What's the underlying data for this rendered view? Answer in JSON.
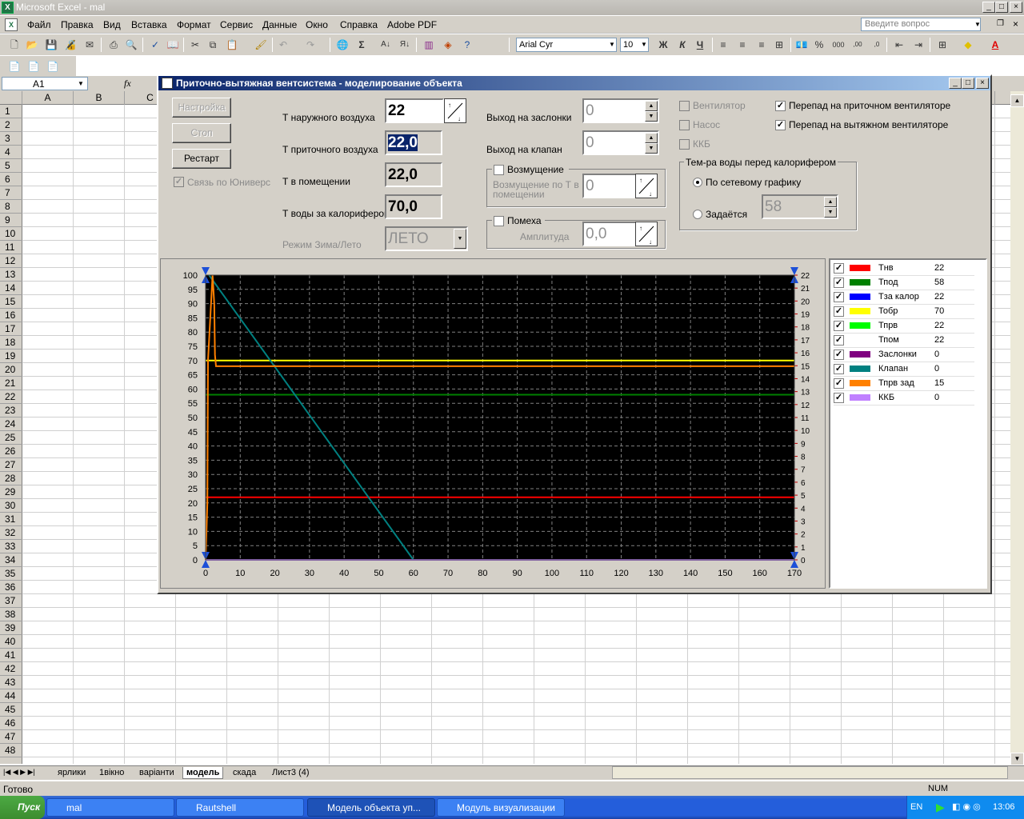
{
  "app": {
    "title": "Microsoft Excel - mal"
  },
  "menu": {
    "items": [
      "Файл",
      "Правка",
      "Вид",
      "Вставка",
      "Формат",
      "Сервис",
      "Данные",
      "Окно",
      "Справка",
      "Adobe PDF"
    ],
    "ask_placeholder": "Введите вопрос"
  },
  "toolbar": {
    "font": "Arial Cyr",
    "size": "10",
    "bold": "Ж",
    "italic": "К",
    "underline": "Ч",
    "percent": "%",
    "thousands": "000"
  },
  "formula": {
    "cell": "A1",
    "fx": "fx"
  },
  "grid": {
    "columns": [
      "A",
      "B",
      "C"
    ],
    "rows": [
      "1",
      "2",
      "3",
      "4",
      "5",
      "6",
      "7",
      "8",
      "9",
      "10",
      "11",
      "12",
      "13",
      "14",
      "15",
      "16",
      "17",
      "18",
      "19",
      "20",
      "21",
      "22",
      "23",
      "24",
      "25",
      "26",
      "27",
      "28",
      "29",
      "30",
      "31",
      "32",
      "33",
      "34",
      "35",
      "36",
      "37",
      "38",
      "39",
      "40",
      "41",
      "42",
      "43",
      "44",
      "45",
      "46",
      "47",
      "48"
    ]
  },
  "sheets": {
    "tabs": [
      "ярлики",
      "1вікно",
      "варіанти",
      "модель",
      "скада",
      "Лист3 (4)"
    ],
    "active": "модель"
  },
  "status": {
    "left": "Готово",
    "num": "NUM"
  },
  "taskbar": {
    "start": "Пуск",
    "tasks": [
      "mal",
      "Rautshell",
      "Модель объекта уп...",
      "Модуль визуализации"
    ],
    "lang": "EN",
    "clock": "13:06"
  },
  "dialog": {
    "title": "Приточно-вытяжная вентсистема - моделирование объекта",
    "buttons": {
      "setup": "Настройка",
      "stop": "Стоп",
      "restart": "Рестарт"
    },
    "link_label": "Связь по Юниверс",
    "fields": {
      "outdoor_label": "Т наружного воздуха",
      "outdoor_value": "22",
      "supply_label": "Т приточного воздуха",
      "supply_value": "22,0",
      "room_label": "Т в помещении",
      "room_value": "22,0",
      "water_label": "Т воды за калорифером",
      "water_value": "70,0",
      "mode_label": "Режим Зима/Лето",
      "mode_value": "ЛЕТО",
      "damper_label": "Выход на заслонки",
      "damper_value": "0",
      "valve_label": "Выход на клапан",
      "valve_value": "0",
      "disturb_label": "Возмущение",
      "disturb_sub_label": "Возмущение по Т в помещении",
      "disturb_value": "0",
      "noise_label": "Помеха",
      "amplitude_label": "Амплитуда",
      "amplitude_value": "0,0"
    },
    "checks": {
      "fan": "Вентилятор",
      "pump": "Насос",
      "kkb": "ККБ",
      "supply_dp": "Перепад на приточном вентиляторе",
      "exhaust_dp": "Перепад на вытяжном вентиляторе"
    },
    "water_group": {
      "title": "Тем-ра воды перед калорифером",
      "by_schedule": "По сетевому графику",
      "manual": "Задаётся",
      "manual_value": "58"
    }
  },
  "legend": [
    {
      "name": "Тнв",
      "value": "22",
      "color": "#ff0000",
      "checked": true
    },
    {
      "name": "Тпод",
      "value": "58",
      "color": "#008000",
      "checked": true
    },
    {
      "name": "Тза калор",
      "value": "22",
      "color": "#0000ff",
      "checked": true
    },
    {
      "name": "Тобр",
      "value": "70",
      "color": "#ffff00",
      "checked": true
    },
    {
      "name": "Тпрв",
      "value": "22",
      "color": "#00ff00",
      "checked": true
    },
    {
      "name": "Тпом",
      "value": "22",
      "color": "#ffffff",
      "checked": true
    },
    {
      "name": "Заслонки",
      "value": "0",
      "color": "#800080",
      "checked": true
    },
    {
      "name": "Клапан",
      "value": "0",
      "color": "#008080",
      "checked": true
    },
    {
      "name": "Тпрв зад",
      "value": "15",
      "color": "#ff8000",
      "checked": true
    },
    {
      "name": "ККБ",
      "value": "0",
      "color": "#c080ff",
      "checked": true
    }
  ],
  "chart_data": {
    "type": "line",
    "x_ticks": [
      0,
      10,
      20,
      30,
      40,
      50,
      60,
      70,
      80,
      90,
      100,
      110,
      120,
      130,
      140,
      150,
      160,
      170
    ],
    "y_left_ticks": [
      0,
      5,
      10,
      15,
      20,
      25,
      30,
      35,
      40,
      45,
      50,
      55,
      60,
      65,
      70,
      75,
      80,
      85,
      90,
      95,
      100
    ],
    "y_right_ticks": [
      0,
      1,
      2,
      3,
      4,
      5,
      6,
      7,
      8,
      9,
      10,
      11,
      12,
      13,
      14,
      15,
      16,
      17,
      18,
      19,
      20,
      21,
      22
    ],
    "xlim": [
      0,
      170
    ],
    "ylim_left": [
      0,
      100
    ],
    "ylim_right": [
      0,
      22
    ],
    "grid": true,
    "series": [
      {
        "name": "Тнв",
        "color": "#ff0000",
        "x": [
          0,
          170
        ],
        "y": [
          22,
          22
        ]
      },
      {
        "name": "Тпод",
        "color": "#008000",
        "x": [
          0,
          170
        ],
        "y": [
          58,
          58
        ]
      },
      {
        "name": "Тобр",
        "color": "#ffff00",
        "x": [
          0,
          170
        ],
        "y": [
          70,
          70
        ]
      },
      {
        "name": "Клапан",
        "color": "#008080",
        "x": [
          1,
          60
        ],
        "y": [
          100,
          0
        ]
      },
      {
        "name": "Тпрв зад",
        "color": "#ff8000",
        "x": [
          0,
          0.5,
          0.7,
          2,
          2.5,
          2.7,
          3,
          170
        ],
        "y": [
          0,
          20,
          70,
          100,
          90,
          72,
          68,
          68
        ]
      },
      {
        "name": "ККБ",
        "color": "#c080ff",
        "x": [
          0,
          170
        ],
        "y": [
          0,
          0
        ]
      }
    ]
  }
}
